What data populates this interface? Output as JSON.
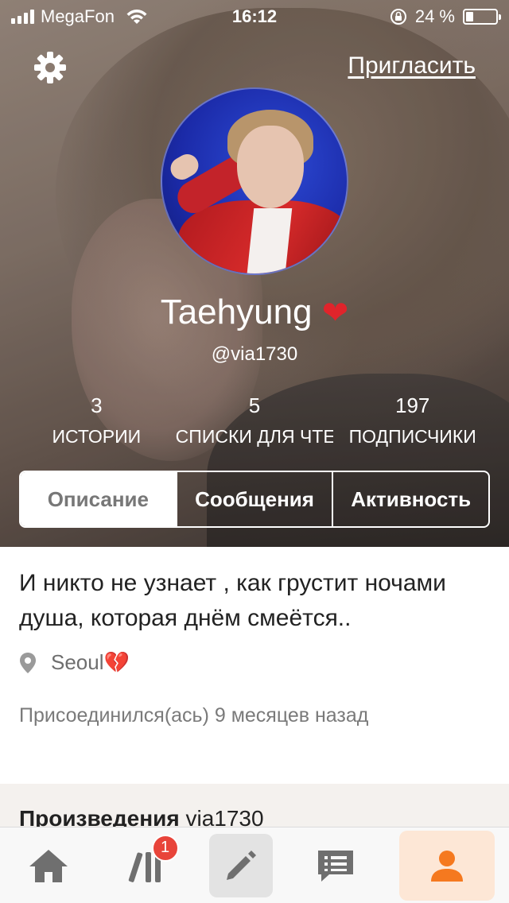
{
  "status_bar": {
    "carrier": "MegaFon",
    "time": "16:12",
    "battery": "24 %",
    "battery_level": 0.24
  },
  "header": {
    "invite_label": "Пригласить",
    "settings_icon": "gear-icon"
  },
  "profile": {
    "name": "Taehyung",
    "name_emoji": "❤",
    "handle": "@via1730"
  },
  "stats": [
    {
      "value": "3",
      "label": "ИСТОРИИ"
    },
    {
      "value": "5",
      "label": "СПИСКИ ДЛЯ ЧТЕ"
    },
    {
      "value": "197",
      "label": "ПОДПИСЧИКИ"
    }
  ],
  "tabs": [
    {
      "label": "Описание",
      "active": true
    },
    {
      "label": "Сообщения",
      "active": false
    },
    {
      "label": "Активность",
      "active": false
    }
  ],
  "about": {
    "bio": "И никто не узнает , как грустит ночами душа, которая днём смеётся..",
    "location": "Seoul",
    "location_emoji": "💔",
    "joined": "Присоединился(ась) 9 месяцев назад"
  },
  "works": {
    "title_prefix": "Произведения",
    "username": "via1730"
  },
  "bottom_nav": {
    "items": [
      "home-icon",
      "library-icon",
      "write-icon",
      "messages-icon",
      "profile-icon"
    ],
    "library_badge": "1",
    "active_color": "#f5791f"
  }
}
